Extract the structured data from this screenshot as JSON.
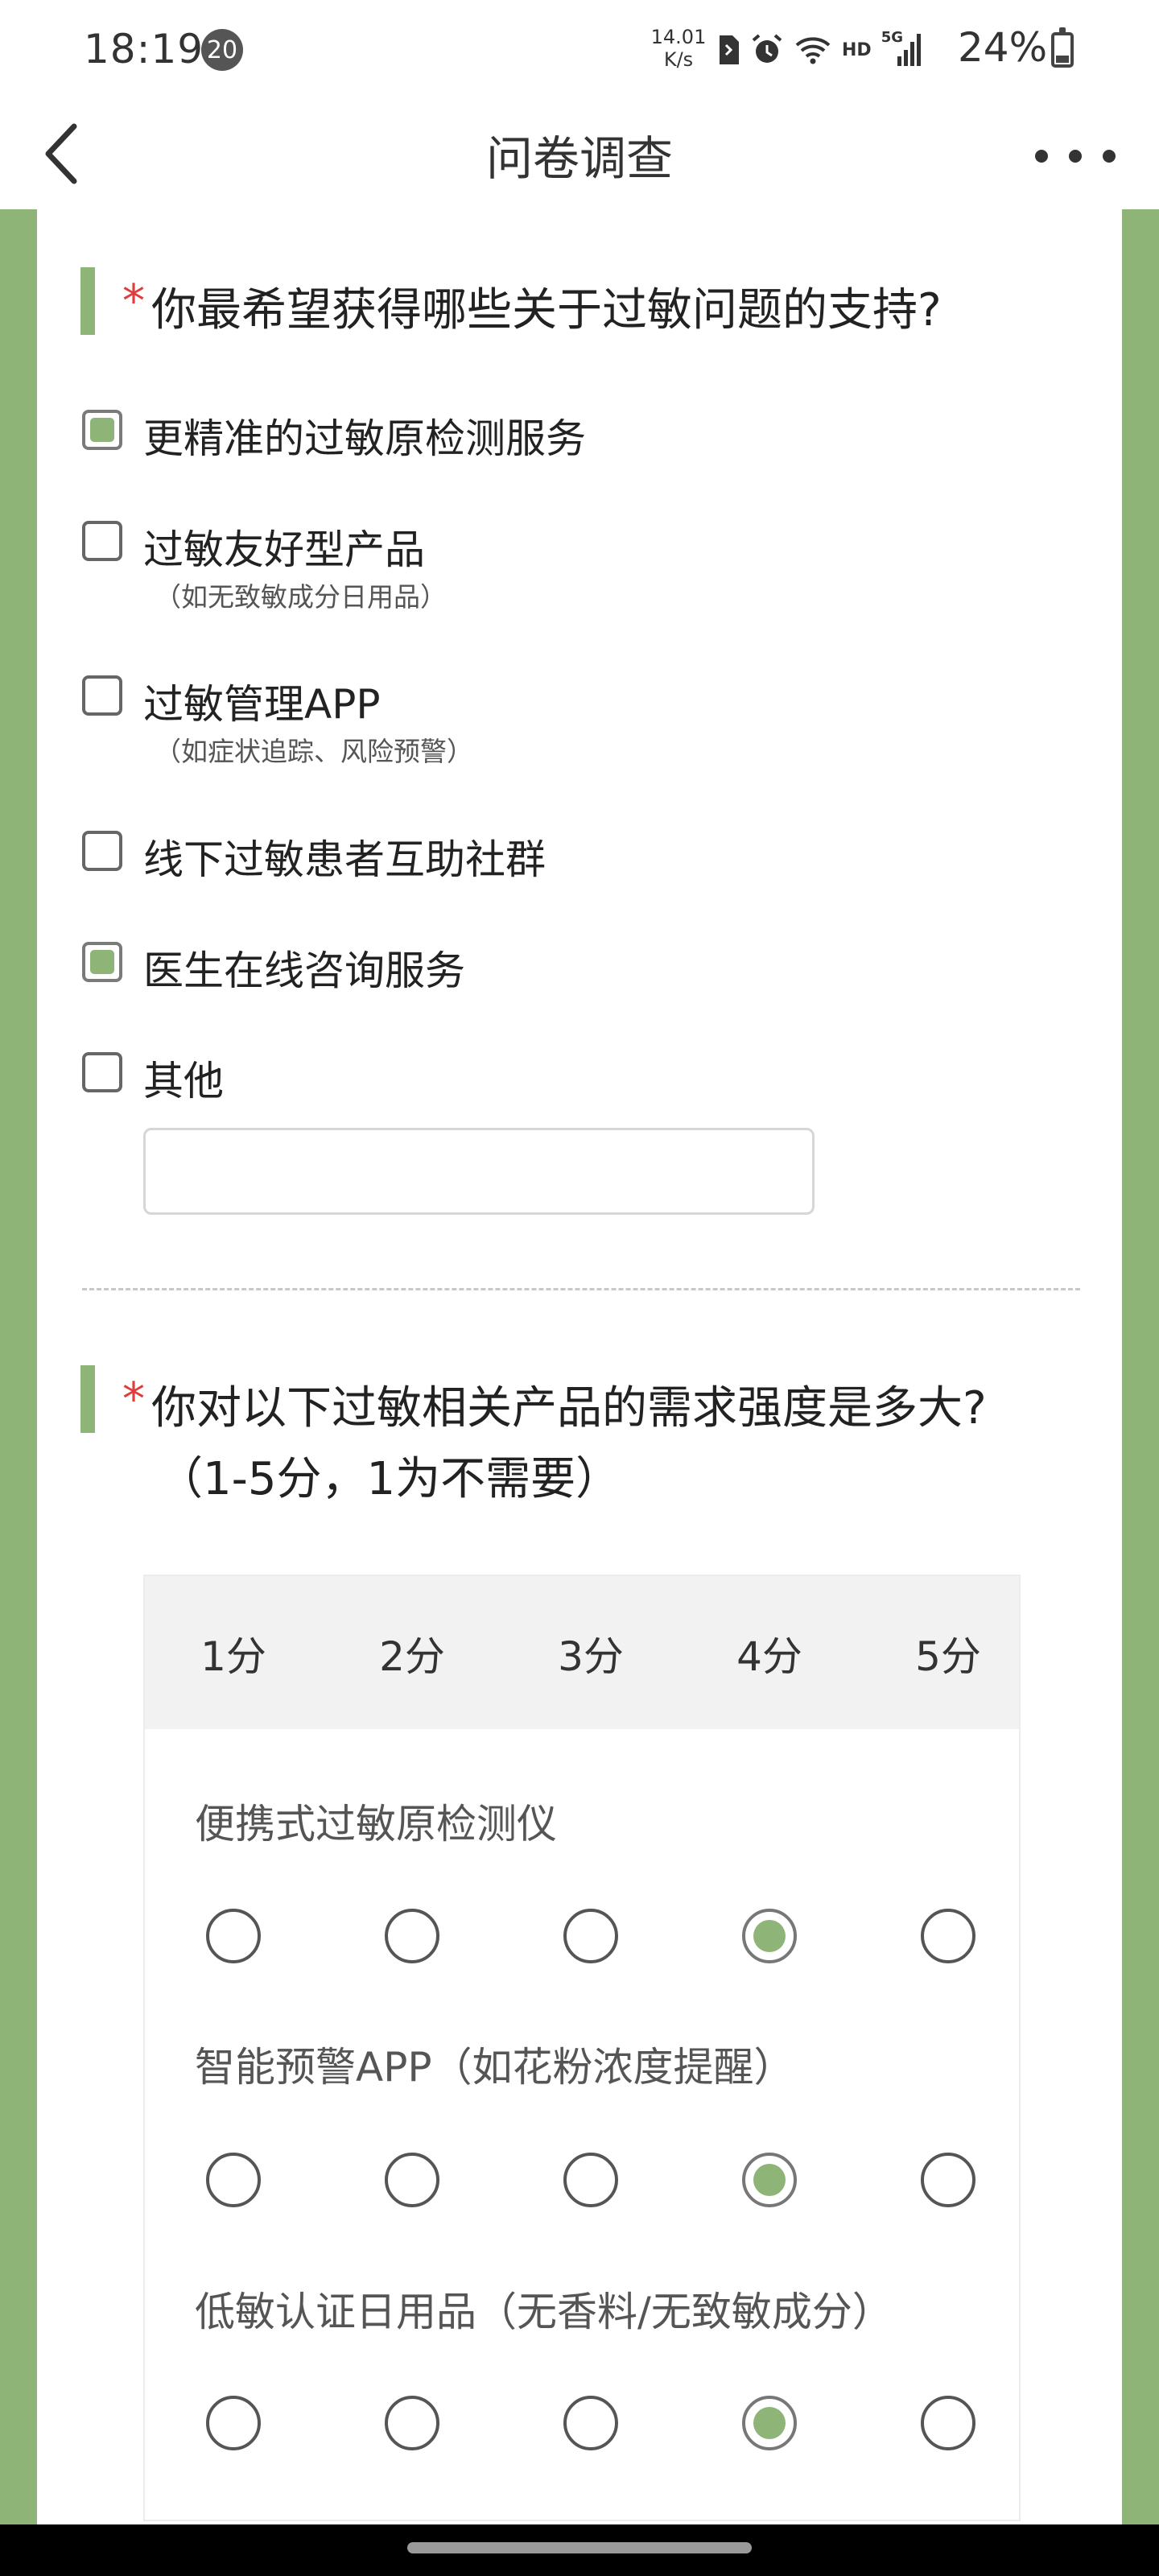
{
  "status_bar": {
    "time": "18:19",
    "notification_count": "20",
    "net_speed_value": "14.01",
    "net_speed_unit": "K/s",
    "hd_label": "HD",
    "network_label": "5G",
    "battery_percent": "24%",
    "battery_level": 0.24
  },
  "nav": {
    "title": "问卷调查"
  },
  "question1": {
    "required_mark": "*",
    "title": "你最希望获得哪些关于过敏问题的支持?",
    "options": [
      {
        "label": "更精准的过敏原检测服务",
        "note": "",
        "checked": true
      },
      {
        "label": "过敏友好型产品",
        "note": "（如无致敏成分日用品）",
        "checked": false
      },
      {
        "label": "过敏管理APP",
        "note": "（如症状追踪、风险预警）",
        "checked": false
      },
      {
        "label": "线下过敏患者互助社群",
        "note": "",
        "checked": false
      },
      {
        "label": "医生在线咨询服务",
        "note": "",
        "checked": true
      },
      {
        "label": "其他",
        "note": "",
        "checked": false
      }
    ],
    "other_input_value": ""
  },
  "question2": {
    "required_mark": "*",
    "title_line1": "你对以下过敏相关产品的需求强度是多大?",
    "title_line2": "（1-5分，1为不需要）",
    "scale_labels": [
      "1分",
      "2分",
      "3分",
      "4分",
      "5分"
    ],
    "rows": [
      {
        "label": "便携式过敏原检测仪",
        "selected": 4
      },
      {
        "label": "智能预警APP（如花粉浓度提醒）",
        "selected": 4
      },
      {
        "label": "低敏认证日用品（无香料/无致敏成分）",
        "selected": 4
      }
    ]
  },
  "colors": {
    "accent_green": "#8fb478",
    "required_red": "#e23b3b"
  },
  "icons": {
    "back": "chevron-left-icon",
    "more": "more-dots-icon"
  }
}
